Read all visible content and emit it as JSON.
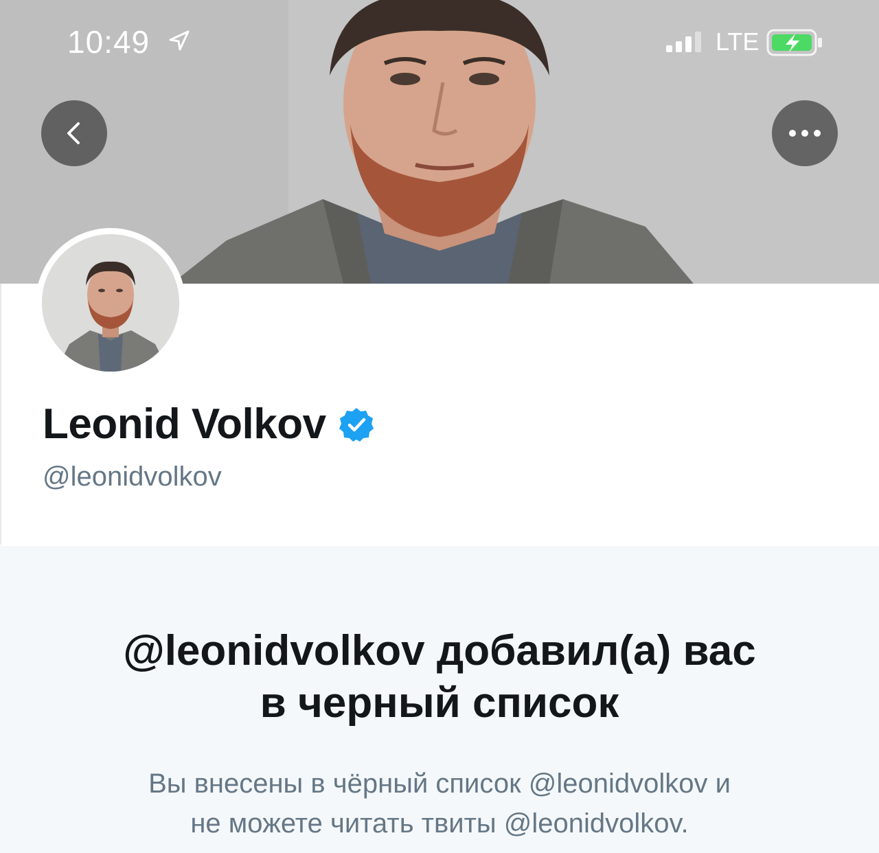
{
  "status_bar": {
    "time": "10:49",
    "network": "LTE"
  },
  "icons": {
    "back": "chevron-left-icon",
    "more": "ellipsis-icon",
    "verified": "verified-badge-icon",
    "location": "location-arrow-icon",
    "signal": "signal-bars-icon",
    "battery": "battery-charging-icon"
  },
  "profile": {
    "name": "Leonid Volkov",
    "handle": "@leonidvolkov"
  },
  "blocked": {
    "title_line1": "@leonidvolkov добавил(а) вас",
    "title_line2": "в черный список",
    "desc_line1": "Вы внесены в чёрный список @leonidvolkov и",
    "desc_line2": "не можете читать твиты @leonidvolkov."
  },
  "colors": {
    "verified": "#1da1f2",
    "text_primary": "#14171a",
    "text_secondary": "#657786",
    "panel_bg": "#f5f8fa",
    "battery_charging": "#4cd964"
  }
}
